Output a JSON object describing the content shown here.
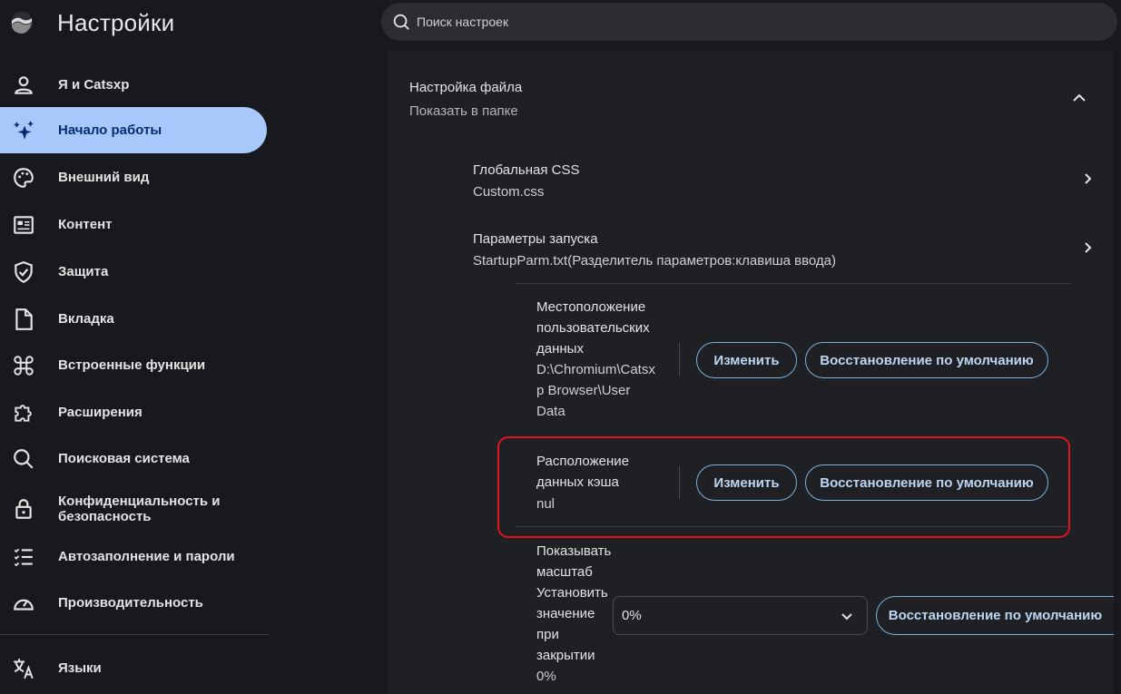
{
  "header": {
    "title": "Настройки",
    "search_placeholder": "Поиск настроек",
    "logo_icon": "browser-logo-icon"
  },
  "sidebar": {
    "active_color": "#a8c7fa",
    "items": [
      {
        "label": "Я и Catsxp",
        "icon": "person-icon"
      },
      {
        "label": "Начало работы",
        "icon": "sparkle-star-icon",
        "active": true
      },
      {
        "label": "Внешний вид",
        "icon": "palette-icon"
      },
      {
        "label": "Контент",
        "icon": "article-icon"
      },
      {
        "label": "Защита",
        "icon": "shield-check-icon"
      },
      {
        "label": "Вкладка",
        "icon": "document-icon"
      },
      {
        "label": "Встроенные функции",
        "icon": "command-key-icon"
      },
      {
        "label": "Расширения",
        "icon": "puzzle-icon"
      },
      {
        "label": "Поисковая система",
        "icon": "search-icon"
      },
      {
        "label": "Конфиденциальность и безопасность",
        "icon": "lock-icon"
      },
      {
        "label": "Автозаполнение и пароли",
        "icon": "checklist-icon"
      },
      {
        "label": "Производительность",
        "icon": "speedometer-icon"
      },
      {
        "label": "Языки",
        "icon": "translate-icon"
      }
    ]
  },
  "main": {
    "section": {
      "title": "Настройка файла",
      "subtitle": "Показать в папке"
    },
    "global_css": {
      "title": "Глобальная CSS",
      "subtitle": "Custom.css"
    },
    "startup": {
      "title": "Параметры запуска",
      "subtitle": "StartupParm.txt(Разделитель параметров:клавиша ввода)"
    },
    "user_data": {
      "title_lines": [
        "Местоположение",
        "пользовательских",
        "данных"
      ],
      "value_lines": [
        "D:\\Chromium\\Catsx",
        "p Browser\\User",
        "Data"
      ],
      "change_label": "Изменить",
      "reset_label": "Восстановление по умолчанию"
    },
    "cache_data": {
      "title_lines": [
        "Расположение",
        "данных кэша"
      ],
      "value": "nul",
      "change_label": "Изменить",
      "reset_label": "Восстановление по умолчанию"
    },
    "zoom": {
      "title_lines": [
        "Показывать",
        "масштаб"
      ],
      "subtitle_lines": [
        "Установить",
        "значение",
        "при",
        "закрытии"
      ],
      "value": "0%",
      "select_value": "0%",
      "reset_label": "Восстановление по умолчанию"
    }
  },
  "colors": {
    "button_border": "#7fb0e0",
    "button_text": "#bcd6f2",
    "highlight": "#e0141e"
  }
}
